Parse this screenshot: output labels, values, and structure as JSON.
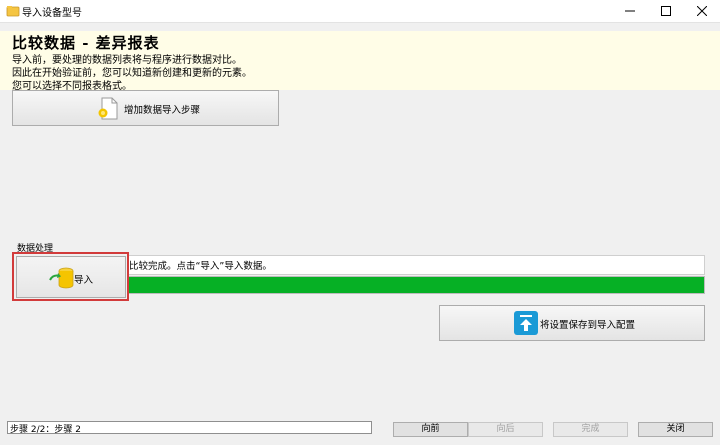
{
  "window": {
    "title": "导入设备型号"
  },
  "info": {
    "title": "比较数据 - 差异报表",
    "lines": [
      "导入前，要处理的数据列表将与程序进行数据对比。",
      "因此在开始验证前，您可以知道新创建和更新的元素。",
      "您可以选择不同报表格式。"
    ]
  },
  "buttons": {
    "add_step": "增加数据导入步骤",
    "import": "导入",
    "save_config": "将设置保存到导入配置"
  },
  "processing": {
    "section_label": "数据处理",
    "status": "比较完成。点击“导入”导入数据。",
    "progress": 1.0
  },
  "footer": {
    "step_text": "步骤 2/2：步骤 2",
    "prev": "向前",
    "next": "向后",
    "finish": "完成",
    "close": "关闭"
  },
  "colors": {
    "info_bg": "#fffde7",
    "progress": "#06b025",
    "highlight": "#d23b3b",
    "save_icon": "#1a9ad6"
  }
}
